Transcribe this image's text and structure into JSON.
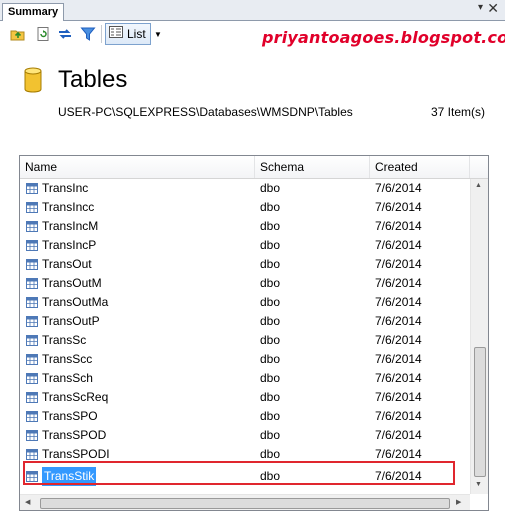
{
  "panel": {
    "tab_label": "Summary",
    "pin": "▾",
    "close": "✕"
  },
  "toolbar": {
    "list_label": "List",
    "list_dropdown": "▼"
  },
  "watermark": "priyantoagoes.blogspot.com",
  "header": {
    "title": "Tables",
    "path": "USER-PC\\SQLEXPRESS\\Databases\\WMSDNP\\Tables",
    "count": "37 Item(s)"
  },
  "grid": {
    "columns": [
      "Name",
      "Schema",
      "Created"
    ],
    "rows": [
      {
        "name": "TransInc",
        "schema": "dbo",
        "created": "7/6/2014"
      },
      {
        "name": "TransIncc",
        "schema": "dbo",
        "created": "7/6/2014"
      },
      {
        "name": "TransIncM",
        "schema": "dbo",
        "created": "7/6/2014"
      },
      {
        "name": "TransIncP",
        "schema": "dbo",
        "created": "7/6/2014"
      },
      {
        "name": "TransOut",
        "schema": "dbo",
        "created": "7/6/2014"
      },
      {
        "name": "TransOutM",
        "schema": "dbo",
        "created": "7/6/2014"
      },
      {
        "name": "TransOutMa",
        "schema": "dbo",
        "created": "7/6/2014"
      },
      {
        "name": "TransOutP",
        "schema": "dbo",
        "created": "7/6/2014"
      },
      {
        "name": "TransSc",
        "schema": "dbo",
        "created": "7/6/2014"
      },
      {
        "name": "TransScc",
        "schema": "dbo",
        "created": "7/6/2014"
      },
      {
        "name": "TransSch",
        "schema": "dbo",
        "created": "7/6/2014"
      },
      {
        "name": "TransScReq",
        "schema": "dbo",
        "created": "7/6/2014"
      },
      {
        "name": "TransSPO",
        "schema": "dbo",
        "created": "7/6/2014"
      },
      {
        "name": "TransSPOD",
        "schema": "dbo",
        "created": "7/6/2014"
      },
      {
        "name": "TransSPODI",
        "schema": "dbo",
        "created": "7/6/2014"
      },
      {
        "name": "TransStik",
        "schema": "dbo",
        "created": "7/6/2014",
        "selected": true
      }
    ]
  },
  "colors": {
    "watermark": "#e1002a",
    "selection": "#3399ff",
    "highlight_box": "#e0262e"
  },
  "icons": [
    "up-folder-icon",
    "refresh-icon",
    "sync-icon",
    "filter-icon",
    "list-view-icon",
    "database-icon",
    "table-icon"
  ]
}
